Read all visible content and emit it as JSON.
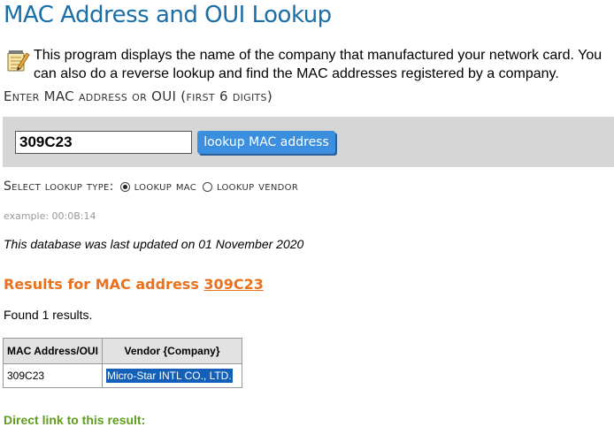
{
  "page_title": "MAC Address and OUI Lookup",
  "intro_text": "This program displays the name of the company that manufactured your network card. You can also do a reverse lookup and find the MAC addresses registered by a company.",
  "enter_label": "Enter MAC address or OUI (first 6 digits)",
  "search": {
    "value": "309C23",
    "button_label": "lookup MAC address"
  },
  "lookup_type": {
    "label": "Select lookup type:",
    "options": [
      {
        "label": "lookup mac",
        "checked": true
      },
      {
        "label": "lookup vendor",
        "checked": false
      }
    ]
  },
  "example": "example: 00:0B:14",
  "updated": "This database was last updated on 01 November 2020",
  "results": {
    "heading": "Results for MAC address",
    "mac": "309C23",
    "found": "Found 1 results.",
    "columns": [
      "MAC Address/OUI",
      "Vendor {Company}"
    ],
    "rows": [
      {
        "mac": "309C23",
        "vendor": "Micro-Star INTL CO., LTD."
      }
    ]
  },
  "direct_link_label": "Direct link to this result:",
  "colors": {
    "title": "#1a6fa8",
    "button": "#3b8fde",
    "results_heading": "#e8721f",
    "direct_link": "#5e9e1c",
    "selection": "#1460b8"
  },
  "icons": {
    "intro": "notepad-pencil-icon"
  }
}
